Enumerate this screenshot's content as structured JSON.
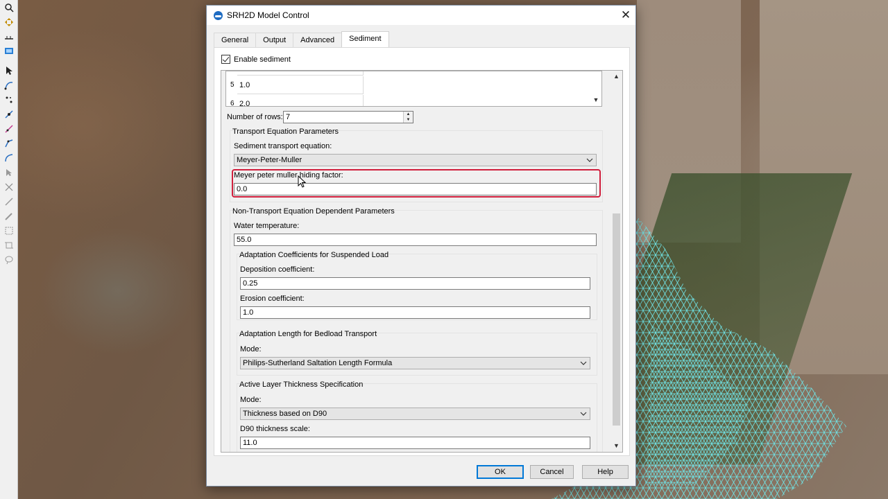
{
  "dialog": {
    "title": "SRH2D Model Control",
    "tabs": [
      {
        "label": "General",
        "active": false
      },
      {
        "label": "Output",
        "active": false
      },
      {
        "label": "Advanced",
        "active": false
      },
      {
        "label": "Sediment",
        "active": true
      }
    ],
    "enable_sediment": {
      "label": "Enable sediment",
      "checked": true
    },
    "table": {
      "rows": [
        {
          "num": "5",
          "value": "1.0"
        },
        {
          "num": "6",
          "value": "2.0"
        }
      ]
    },
    "number_of_rows": {
      "label": "Number of rows:",
      "value": "7"
    },
    "transport": {
      "group_title": "Transport Equation Parameters",
      "equation_label": "Sediment transport equation:",
      "equation_value": "Meyer-Peter-Muller",
      "hiding_label": "Meyer peter muller hiding factor:",
      "hiding_value": "0.0"
    },
    "non_transport": {
      "group_title": "Non-Transport Equation Dependent Parameters",
      "water_temp_label": "Water temperature:",
      "water_temp_value": "55.0",
      "adaptation_suspended": {
        "title": "Adaptation Coefficients for Suspended Load",
        "deposition_label": "Deposition coefficient:",
        "deposition_value": "0.25",
        "erosion_label": "Erosion coefficient:",
        "erosion_value": "1.0"
      },
      "adaptation_bedload": {
        "title": "Adaptation Length for Bedload Transport",
        "mode_label": "Mode:",
        "mode_value": "Philips-Sutherland Saltation Length Formula"
      },
      "active_layer": {
        "title": "Active Layer Thickness Specification",
        "mode_label": "Mode:",
        "mode_value": "Thickness based on D90",
        "d90_label": "D90 thickness scale:",
        "d90_value": "11.0"
      }
    },
    "buttons": {
      "ok": "OK",
      "cancel": "Cancel",
      "help": "Help"
    }
  },
  "colors": {
    "highlight": "#d01e3c",
    "mesh": "#6fe3e6",
    "ok_border": "#0078d7"
  }
}
